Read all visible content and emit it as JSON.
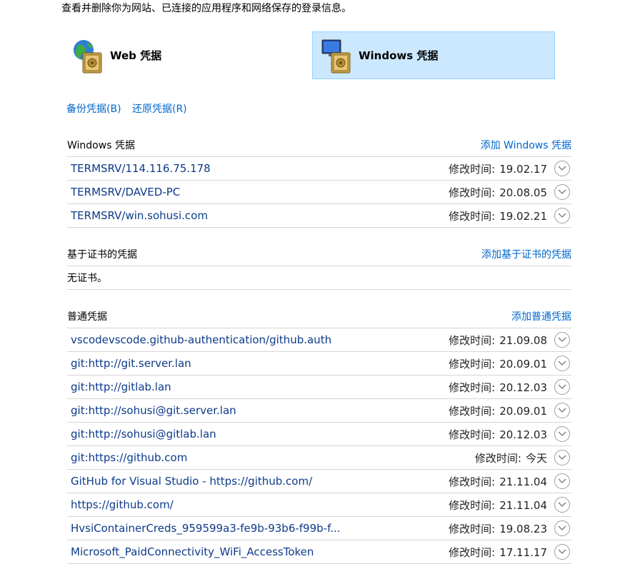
{
  "intro": "查看并删除你为网站、已连接的应用程序和网络保存的登录信息。",
  "vaults": {
    "web": {
      "label": "Web 凭据"
    },
    "windows": {
      "label": "Windows 凭据"
    }
  },
  "actions": {
    "backup": "备份凭据(B)",
    "restore": "还原凭据(R)"
  },
  "modified_label": "修改时间:",
  "windows_section": {
    "title": "Windows 凭据",
    "add": "添加 Windows 凭据",
    "items": [
      {
        "name": "TERMSRV/114.116.75.178",
        "modified": "19.02.17"
      },
      {
        "name": "TERMSRV/DAVED-PC",
        "modified": "20.08.05"
      },
      {
        "name": "TERMSRV/win.sohusi.com",
        "modified": "19.02.21"
      }
    ]
  },
  "cert_section": {
    "title": "基于证书的凭据",
    "add": "添加基于证书的凭据",
    "empty": "无证书。"
  },
  "generic_section": {
    "title": "普通凭据",
    "add": "添加普通凭据",
    "items": [
      {
        "name": "vscodevscode.github-authentication/github.auth",
        "modified": "21.09.08"
      },
      {
        "name": "git:http://git.server.lan",
        "modified": "20.09.01"
      },
      {
        "name": "git:http://gitlab.lan",
        "modified": "20.12.03"
      },
      {
        "name": "git:http://sohusi@git.server.lan",
        "modified": "20.09.01"
      },
      {
        "name": "git:http://sohusi@gitlab.lan",
        "modified": "20.12.03"
      },
      {
        "name": "git:https://github.com",
        "modified": "今天"
      },
      {
        "name": "GitHub for Visual Studio - https://github.com/",
        "modified": "21.11.04"
      },
      {
        "name": "https://github.com/",
        "modified": "21.11.04"
      },
      {
        "name": "HvsiContainerCreds_959599a3-fe9b-93b6-f99b-f...",
        "modified": "19.08.23"
      },
      {
        "name": "Microsoft_PaidConnectivity_WiFi_AccessToken",
        "modified": "17.11.17"
      }
    ]
  }
}
